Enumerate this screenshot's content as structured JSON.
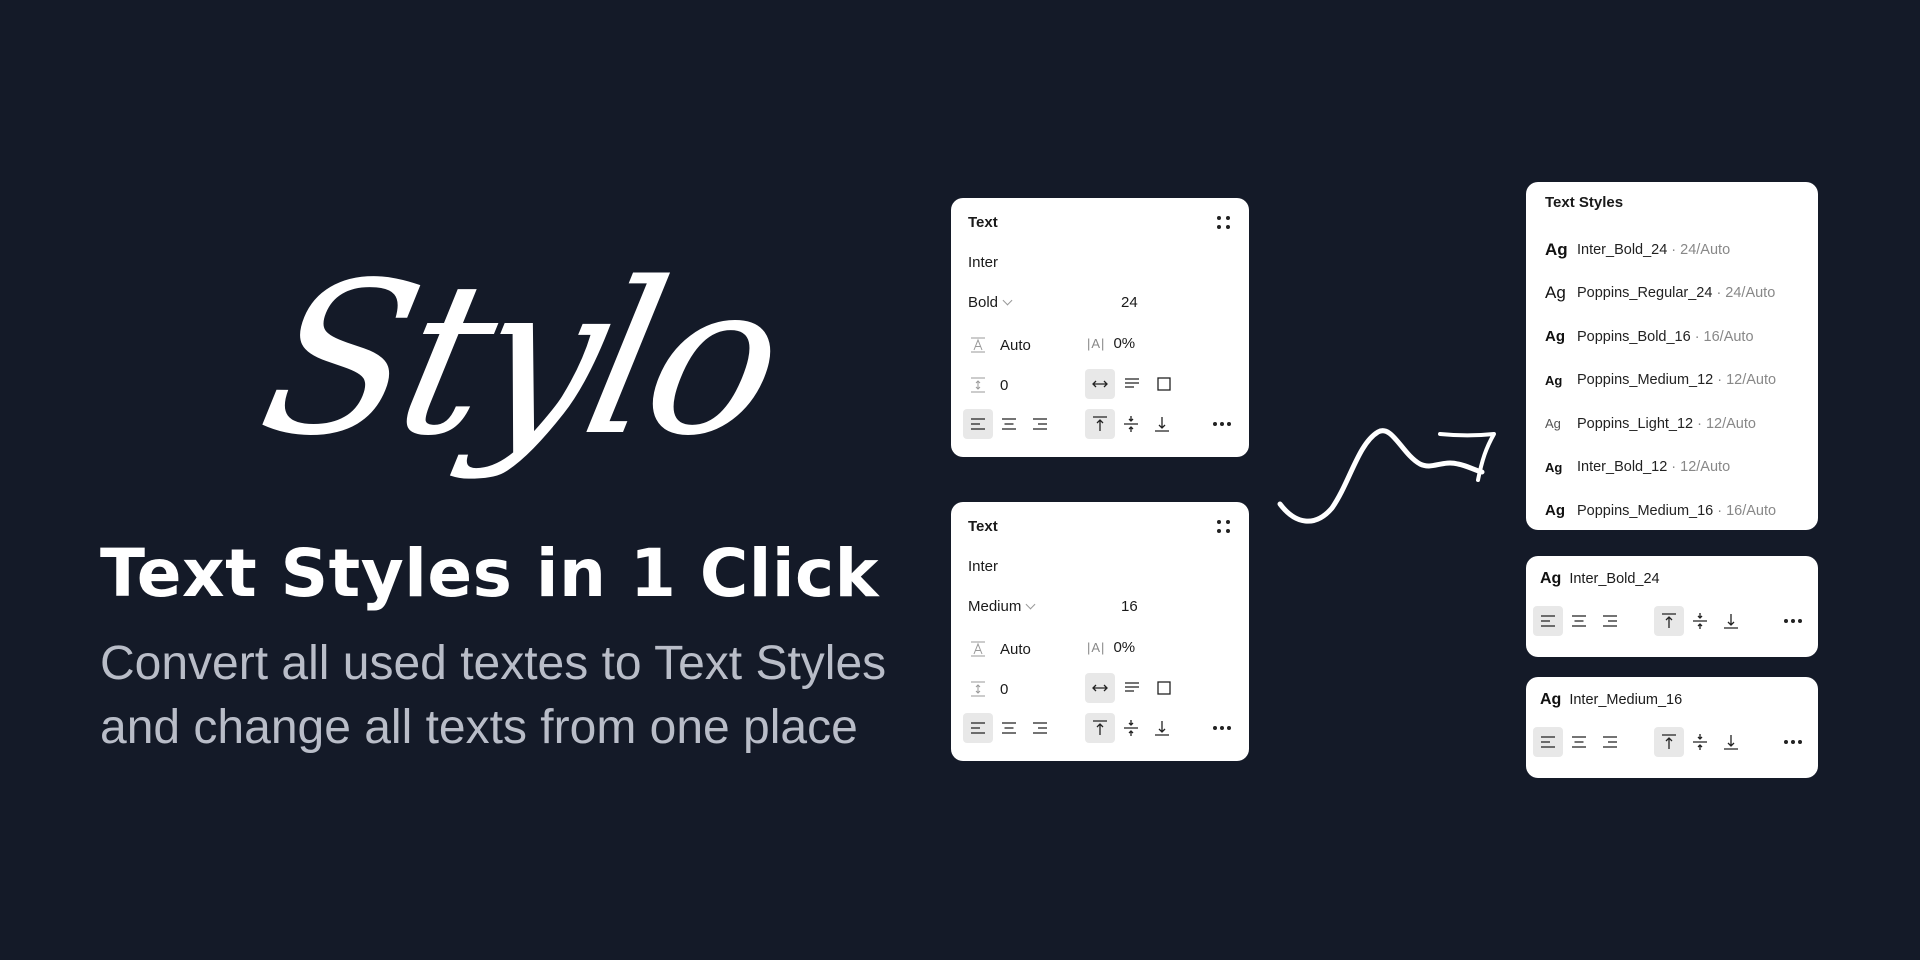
{
  "hero": {
    "logo": "Stylo",
    "headline": "Text Styles in 1 Click",
    "subline": "Convert all used textes to Text Styles and change all texts from one place"
  },
  "text_panels": [
    {
      "title": "Text",
      "font": "Inter",
      "weight": "Bold",
      "size": "24",
      "line_height": "Auto",
      "letter_spacing": "0%",
      "paragraph_spacing": "0"
    },
    {
      "title": "Text",
      "font": "Inter",
      "weight": "Medium",
      "size": "16",
      "line_height": "Auto",
      "letter_spacing": "0%",
      "paragraph_spacing": "0"
    }
  ],
  "styles_panel": {
    "title": "Text Styles",
    "items": [
      {
        "ag": "Ag",
        "name": "Inter_Bold_24",
        "meta": "· 24/Auto"
      },
      {
        "ag": "Ag",
        "name": "Poppins_Regular_24",
        "meta": "· 24/Auto"
      },
      {
        "ag": "Ag",
        "name": "Poppins_Bold_16",
        "meta": "· 16/Auto"
      },
      {
        "ag": "Ag",
        "name": "Poppins_Medium_12",
        "meta": "· 12/Auto"
      },
      {
        "ag": "Ag",
        "name": "Poppins_Light_12",
        "meta": "· 12/Auto"
      },
      {
        "ag": "Ag",
        "name": "Inter_Bold_12",
        "meta": "· 12/Auto"
      },
      {
        "ag": "Ag",
        "name": "Poppins_Medium_16",
        "meta": "· 16/Auto"
      }
    ]
  },
  "applied_styles": [
    {
      "ag": "Ag",
      "name": "Inter_Bold_24"
    },
    {
      "ag": "Ag",
      "name": "Inter_Medium_16"
    }
  ],
  "icons": {
    "drag": "drag-handle-icon",
    "line_height": "line-height-icon",
    "letter_spacing": "letter-spacing-icon",
    "paragraph_spacing": "paragraph-spacing-icon",
    "auto_width": "auto-width-icon",
    "auto_height": "auto-height-icon",
    "fixed_size": "fixed-size-icon",
    "align_left": "align-left-icon",
    "align_center": "align-center-icon",
    "align_right": "align-right-icon",
    "align_top": "align-top-icon",
    "align_middle": "align-middle-icon",
    "align_bottom": "align-bottom-icon",
    "more": "more-icon",
    "arrow": "squiggle-arrow-icon"
  },
  "colors": {
    "background": "#141a28",
    "panel": "#ffffff",
    "headline": "#ffffff",
    "subline": "#b9bdc8",
    "active_button": "#e8e8e8"
  }
}
